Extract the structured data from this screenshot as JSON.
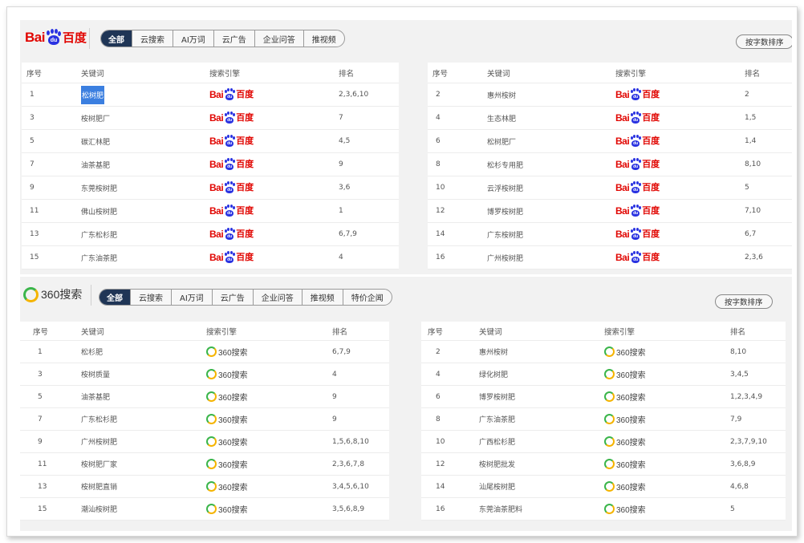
{
  "baidu_section": {
    "logo": {
      "latin": "Bai",
      "paw_text": "du",
      "cn": "百度"
    },
    "tabs": [
      "全部",
      "云搜索",
      "AI万词",
      "云广告",
      "企业问答",
      "推视频"
    ],
    "active_tab": "全部",
    "sort_button": "按字数排序",
    "headers": {
      "idx": "序号",
      "keyword": "关键词",
      "engine": "搜索引擎",
      "rank": "排名"
    },
    "left_rows": [
      {
        "idx": "1",
        "keyword": "松树肥",
        "rank": "2,3,6,10"
      },
      {
        "idx": "3",
        "keyword": "桉树肥厂",
        "rank": "7"
      },
      {
        "idx": "5",
        "keyword": "碳汇林肥",
        "rank": "4,5"
      },
      {
        "idx": "7",
        "keyword": "油茶基肥",
        "rank": "9"
      },
      {
        "idx": "9",
        "keyword": "东莞桉树肥",
        "rank": "3,6"
      },
      {
        "idx": "11",
        "keyword": "佛山桉树肥",
        "rank": "1"
      },
      {
        "idx": "13",
        "keyword": "广东松杉肥",
        "rank": "6,7,9"
      },
      {
        "idx": "15",
        "keyword": "广东油茶肥",
        "rank": "4"
      }
    ],
    "right_rows": [
      {
        "idx": "2",
        "keyword": "惠州桉树",
        "rank": "2"
      },
      {
        "idx": "4",
        "keyword": "生态林肥",
        "rank": "1,5"
      },
      {
        "idx": "6",
        "keyword": "松树肥厂",
        "rank": "1,4"
      },
      {
        "idx": "8",
        "keyword": "松杉专用肥",
        "rank": "8,10"
      },
      {
        "idx": "10",
        "keyword": "云浮桉树肥",
        "rank": "5"
      },
      {
        "idx": "12",
        "keyword": "博罗桉树肥",
        "rank": "7,10"
      },
      {
        "idx": "14",
        "keyword": "广东桉树肥",
        "rank": "6,7"
      },
      {
        "idx": "16",
        "keyword": "广州桉树肥",
        "rank": "2,3,6"
      }
    ]
  },
  "s360_section": {
    "logo": {
      "text": "360搜索"
    },
    "tabs": [
      "全部",
      "云搜索",
      "AI万词",
      "云广告",
      "企业问答",
      "推视频",
      "特价企闻"
    ],
    "active_tab": "全部",
    "sort_button": "按字数排序",
    "headers": {
      "idx": "序号",
      "keyword": "关键词",
      "engine": "搜索引擎",
      "rank": "排名"
    },
    "left_rows": [
      {
        "idx": "1",
        "keyword": "松杉肥",
        "rank": "6,7,9"
      },
      {
        "idx": "3",
        "keyword": "桉树质量",
        "rank": "4"
      },
      {
        "idx": "5",
        "keyword": "油茶基肥",
        "rank": "9"
      },
      {
        "idx": "7",
        "keyword": "广东松杉肥",
        "rank": "9"
      },
      {
        "idx": "9",
        "keyword": "广州桉树肥",
        "rank": "1,5,6,8,10"
      },
      {
        "idx": "11",
        "keyword": "桉树肥厂家",
        "rank": "2,3,6,7,8"
      },
      {
        "idx": "13",
        "keyword": "桉树肥直销",
        "rank": "3,4,5,6,10"
      },
      {
        "idx": "15",
        "keyword": "潮汕桉树肥",
        "rank": "3,5,6,8,9"
      }
    ],
    "right_rows": [
      {
        "idx": "2",
        "keyword": "惠州桉树",
        "rank": "8,10"
      },
      {
        "idx": "4",
        "keyword": "绿化树肥",
        "rank": "3,4,5"
      },
      {
        "idx": "6",
        "keyword": "博罗桉树肥",
        "rank": "1,2,3,4,9"
      },
      {
        "idx": "8",
        "keyword": "广东油茶肥",
        "rank": "7,9"
      },
      {
        "idx": "10",
        "keyword": "广西松杉肥",
        "rank": "2,3,7,9,10"
      },
      {
        "idx": "12",
        "keyword": "桉树肥批发",
        "rank": "3,6,8,9"
      },
      {
        "idx": "14",
        "keyword": "汕尾桉树肥",
        "rank": "4,6,8"
      },
      {
        "idx": "16",
        "keyword": "东莞油茶肥料",
        "rank": "5"
      }
    ]
  },
  "colors": {
    "baidu_red": "#e10602",
    "baidu_blue": "#2932e1",
    "tab_active": "#1f3556",
    "s360_green": "#3ab54a",
    "s360_yellow": "#f5b400",
    "highlight": "#3b7fe0"
  }
}
